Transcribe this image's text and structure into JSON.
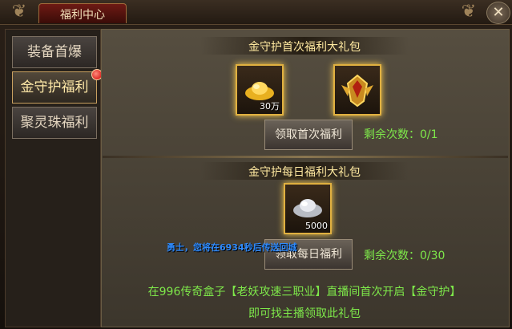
{
  "window": {
    "title": "福利中心",
    "close_label": "✕"
  },
  "sidebar": {
    "items": [
      {
        "label": "装备首爆",
        "active": false
      },
      {
        "label": "金守护福利",
        "active": true,
        "badge": true
      },
      {
        "label": "聚灵珠福利",
        "active": false
      }
    ]
  },
  "packs": [
    {
      "title": "金守护首次福利大礼包",
      "items": [
        {
          "icon": "gold-ingot-icon",
          "count": "30万"
        },
        {
          "icon": "golden-crest-icon",
          "count": ""
        }
      ],
      "button_label": "领取首次福利",
      "remaining": "剩余次数：0/1"
    },
    {
      "title": "金守护每日福利大礼包",
      "items": [
        {
          "icon": "silver-ingot-icon",
          "count": "5000"
        }
      ],
      "button_label": "领取每日福利",
      "remaining": "剩余次数：0/30"
    }
  ],
  "system_message": "勇士，您将在6934秒后传送回城",
  "notice": {
    "line1": "在996传奇盒子【老妖攻速三职业】直播间首次开启【金守护】",
    "line2": "即可找主播领取此礼包"
  },
  "colors": {
    "accent_gold": "#e0b040",
    "remaining_green": "#7ee84a",
    "system_blue": "#2e8bff"
  }
}
